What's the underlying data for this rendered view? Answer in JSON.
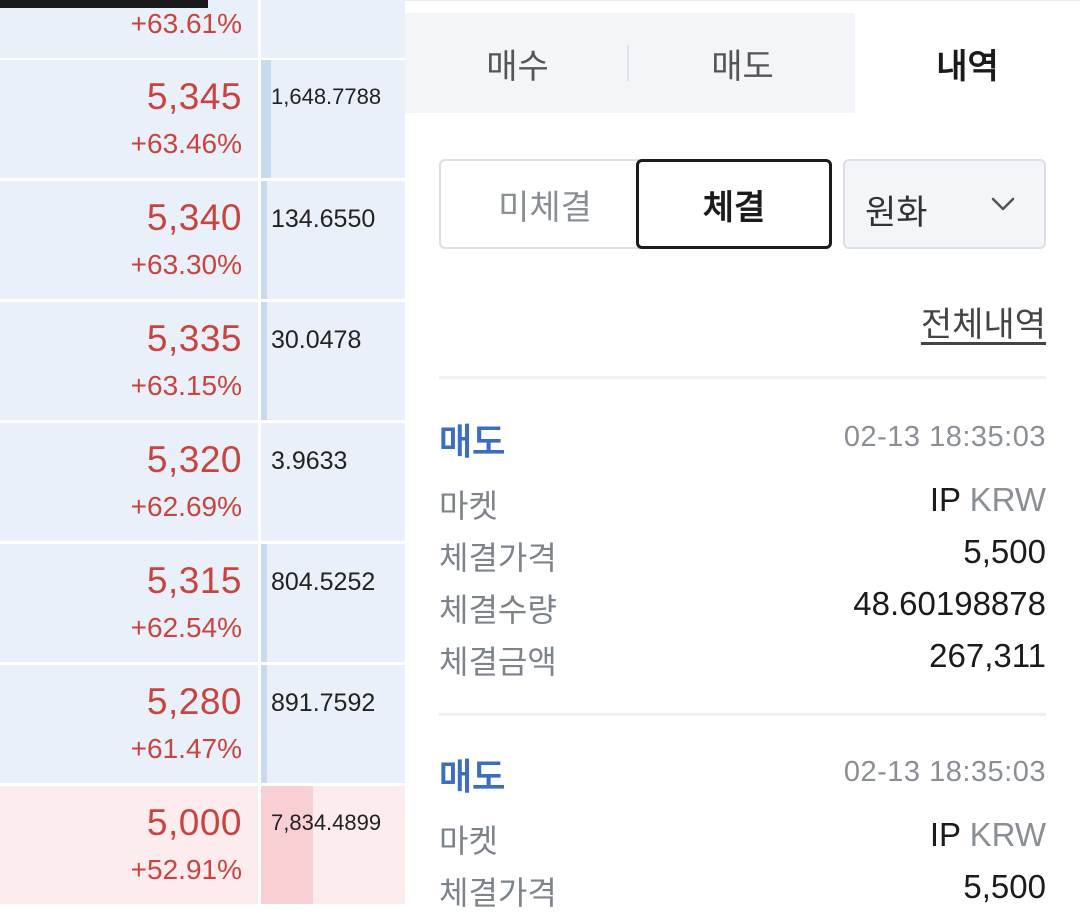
{
  "orderbook": {
    "rows": [
      {
        "price": "",
        "change": "+63.61%",
        "qty": "",
        "side": "ask",
        "fill": 0
      },
      {
        "price": "5,345",
        "change": "+63.46%",
        "qty": "1,648.7788",
        "side": "ask",
        "fill": 0.05
      },
      {
        "price": "5,340",
        "change": "+63.30%",
        "qty": "134.6550",
        "side": "ask",
        "fill": 0.01
      },
      {
        "price": "5,335",
        "change": "+63.15%",
        "qty": "30.0478",
        "side": "ask",
        "fill": 0.005
      },
      {
        "price": "5,320",
        "change": "+62.69%",
        "qty": "3.9633",
        "side": "ask",
        "fill": 0
      },
      {
        "price": "5,315",
        "change": "+62.54%",
        "qty": "804.5252",
        "side": "ask",
        "fill": 0.005
      },
      {
        "price": "5,280",
        "change": "+61.47%",
        "qty": "891.7592",
        "side": "ask",
        "fill": 0.01
      },
      {
        "price": "5,000",
        "change": "+52.91%",
        "qty": "7,834.4899",
        "side": "bid",
        "fill": 0.26
      }
    ]
  },
  "tabs": {
    "buy": "매수",
    "sell": "매도",
    "history": "내역"
  },
  "filter": {
    "unfilled": "미체결",
    "filled": "체결",
    "currency": "원화"
  },
  "all_history_link": "전체내역",
  "labels": {
    "market": "마켓",
    "price": "체결가격",
    "quantity": "체결수량",
    "amount": "체결금액"
  },
  "trades": [
    {
      "type": "매도",
      "time": "02-13 18:35:03",
      "market_symbol": "IP",
      "market_unit": "KRW",
      "price": "5,500",
      "quantity": "48.60198878",
      "amount": "267,311"
    },
    {
      "type": "매도",
      "time": "02-13 18:35:03",
      "market_symbol": "IP",
      "market_unit": "KRW",
      "price": "5,500"
    }
  ],
  "colors": {
    "up": "#c8453f",
    "sell_label": "#3c6ebf",
    "ask_bg": "#e9f0f9",
    "bid_bg": "#fceced"
  },
  "icons": {
    "currency_dropdown": "chevron-down-icon"
  }
}
